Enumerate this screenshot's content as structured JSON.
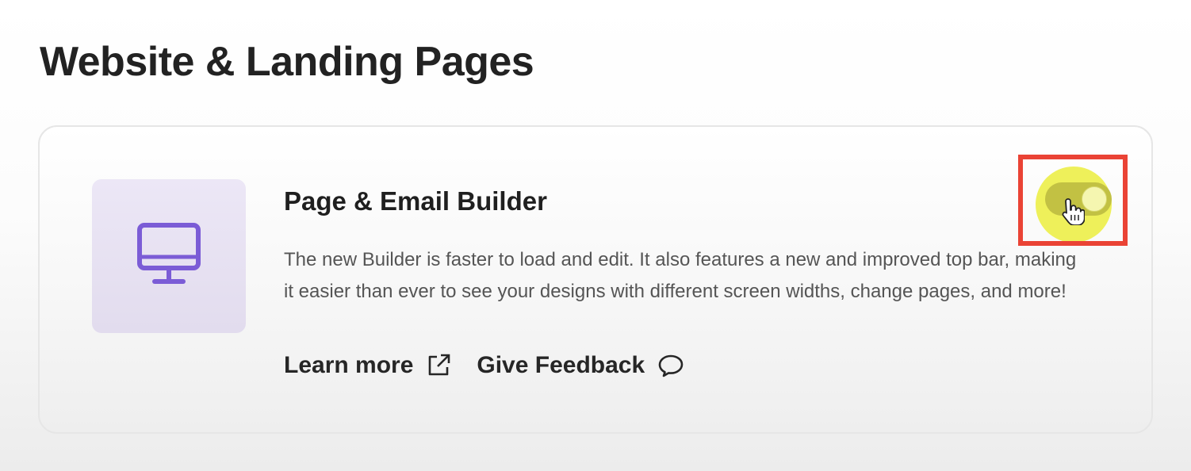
{
  "section": {
    "title": "Website & Landing Pages"
  },
  "feature": {
    "icon": "monitor-icon",
    "title": "Page & Email Builder",
    "description": "The new Builder is faster to load and edit. It also features a new and improved top bar, making it easier than ever to see your designs with different screen widths, change pages, and more!",
    "links": {
      "learn_more": "Learn more",
      "give_feedback": "Give Feedback"
    },
    "toggle": {
      "state": "on",
      "highlighted": true
    }
  },
  "colors": {
    "accent": "#7b5cd6",
    "icon_tile_bg": "#e6e0f1",
    "toggle_highlight": "#eef05a",
    "annotation": "#ea4335"
  }
}
